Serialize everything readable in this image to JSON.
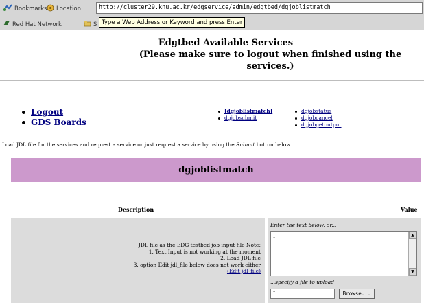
{
  "browser": {
    "bookmarks_label": "Bookmarks",
    "location_label": "Location",
    "url": "http://cluster29.knu.ac.kr/edgservice/admin/edgtbed/dgjoblistmatch",
    "personal_link": "Red Hat Network",
    "personal_link2_partial": "S",
    "tooltip": "Type a Web Address or Keyword and press Enter"
  },
  "page": {
    "title_line1": "Edgtbed Available Services",
    "title_line2": "(Please make sure to logout when finished using the services.)",
    "nav": [
      "Logout",
      "GDS Boards"
    ],
    "services_col1": [
      "[dgjoblistmatch]",
      "dgjobsubmit"
    ],
    "services_col2": [
      "dgjobstatus",
      "dgjobcancel",
      "dgjobgetoutput"
    ],
    "hint_prefix": "Load JDL file for the services and request a service or just request a service by using the ",
    "hint_em": "Submit",
    "hint_suffix": " button below.",
    "banner": "dgjoblistmatch",
    "col_description": "Description",
    "col_value": "Value",
    "desc_lines": [
      "JDL file as the EDG testbed job input file Note:",
      "1. Text Input is not working at the moment",
      "2. Load JDL file",
      "3. option Edit jdl_file below does not work either"
    ],
    "edit_link": "(Edit jdl_file)",
    "textarea_label": "Enter the text below, or...",
    "textarea_value": "I",
    "upload_label": "...specify a file to upload",
    "file_value": "I",
    "browse_label": "Browse..."
  }
}
